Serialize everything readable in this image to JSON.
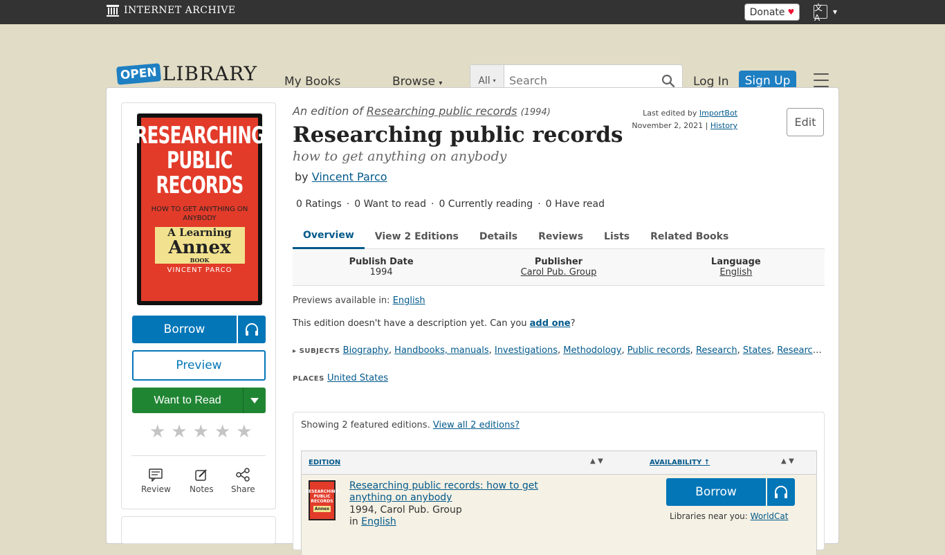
{
  "ia_bar": {
    "brand": "INTERNET ARCHIVE",
    "donate_label": "Donate",
    "heart": "♥",
    "lang_icon_glyph": "文A",
    "lang_caret": "▾"
  },
  "header": {
    "logo_open": "OPEN",
    "logo_library": "LIBRARY",
    "nav_mybooks": "My Books",
    "nav_browse": "Browse",
    "browse_caret": "▾",
    "search_scope": "All",
    "search_caret": "▾",
    "search_placeholder": "Search",
    "login": "Log In",
    "signup": "Sign Up"
  },
  "cover": {
    "title_lines": "RESEARCHING PUBLIC RECORDS",
    "subtitle": "HOW TO GET ANYTHING ON ANYBODY",
    "annex_a": "A Learning",
    "annex_b": "Annex",
    "annex_c": "BOOK",
    "author": "VINCENT PARCO"
  },
  "actions": {
    "borrow": "Borrow",
    "preview": "Preview",
    "want_to_read": "Want to Read",
    "review": "Review",
    "notes": "Notes",
    "share": "Share",
    "star_glyph": "★",
    "rating_value": 0
  },
  "book": {
    "edition_of_prefix": "An edition of",
    "work_title": "Researching public records",
    "work_year": "(1994)",
    "title": "Researching public records",
    "subtitle": "how to get anything on anybody",
    "by": "by",
    "author": "Vincent Parco",
    "last_edited_prefix": "Last edited by",
    "last_edited_by": "ImportBot",
    "last_edited_date": "November 2, 2021",
    "sep": "|",
    "history": "History",
    "edit": "Edit"
  },
  "stats": {
    "ratings": "0 Ratings",
    "sep1": "·",
    "want_to_read": "0 Want to read",
    "sep2": "·",
    "currently_reading": "0 Currently reading",
    "sep3": "·",
    "have_read": "0 Have read"
  },
  "tabs": [
    "Overview",
    "View 2 Editions",
    "Details",
    "Reviews",
    "Lists",
    "Related Books"
  ],
  "info": {
    "publish_date_label": "Publish Date",
    "publish_date": "1994",
    "publisher_label": "Publisher",
    "publisher": "Carol Pub. Group",
    "language_label": "Language",
    "language": "English"
  },
  "previews": {
    "label": "Previews available in:",
    "language": "English"
  },
  "description": {
    "text": "This edition doesn't have a description yet. Can you",
    "link": "add one",
    "end": "?"
  },
  "subjects": {
    "marker": "▸",
    "label": "SUBJECTS",
    "items": [
      "Biography",
      "Handbooks, manuals",
      "Investigations",
      "Methodology",
      "Public records",
      "Research",
      "States",
      "Research…"
    ]
  },
  "places": {
    "label": "PLACES",
    "items": [
      "United States"
    ]
  },
  "editions": {
    "showing": "Showing 2 featured editions.",
    "view_all": "View all 2 editions?",
    "col_edition": "EDITION",
    "col_availability": "AVAILABILITY ↑",
    "sort_glyph": "▲ ▼",
    "row": {
      "title": "Researching public records: how to get anything on anybody",
      "meta": "1994, Carol Pub. Group",
      "in_prefix": "in",
      "language": "English",
      "borrow": "Borrow",
      "libs_prefix": "Libraries near you:",
      "libs_link": "WorldCat"
    }
  }
}
